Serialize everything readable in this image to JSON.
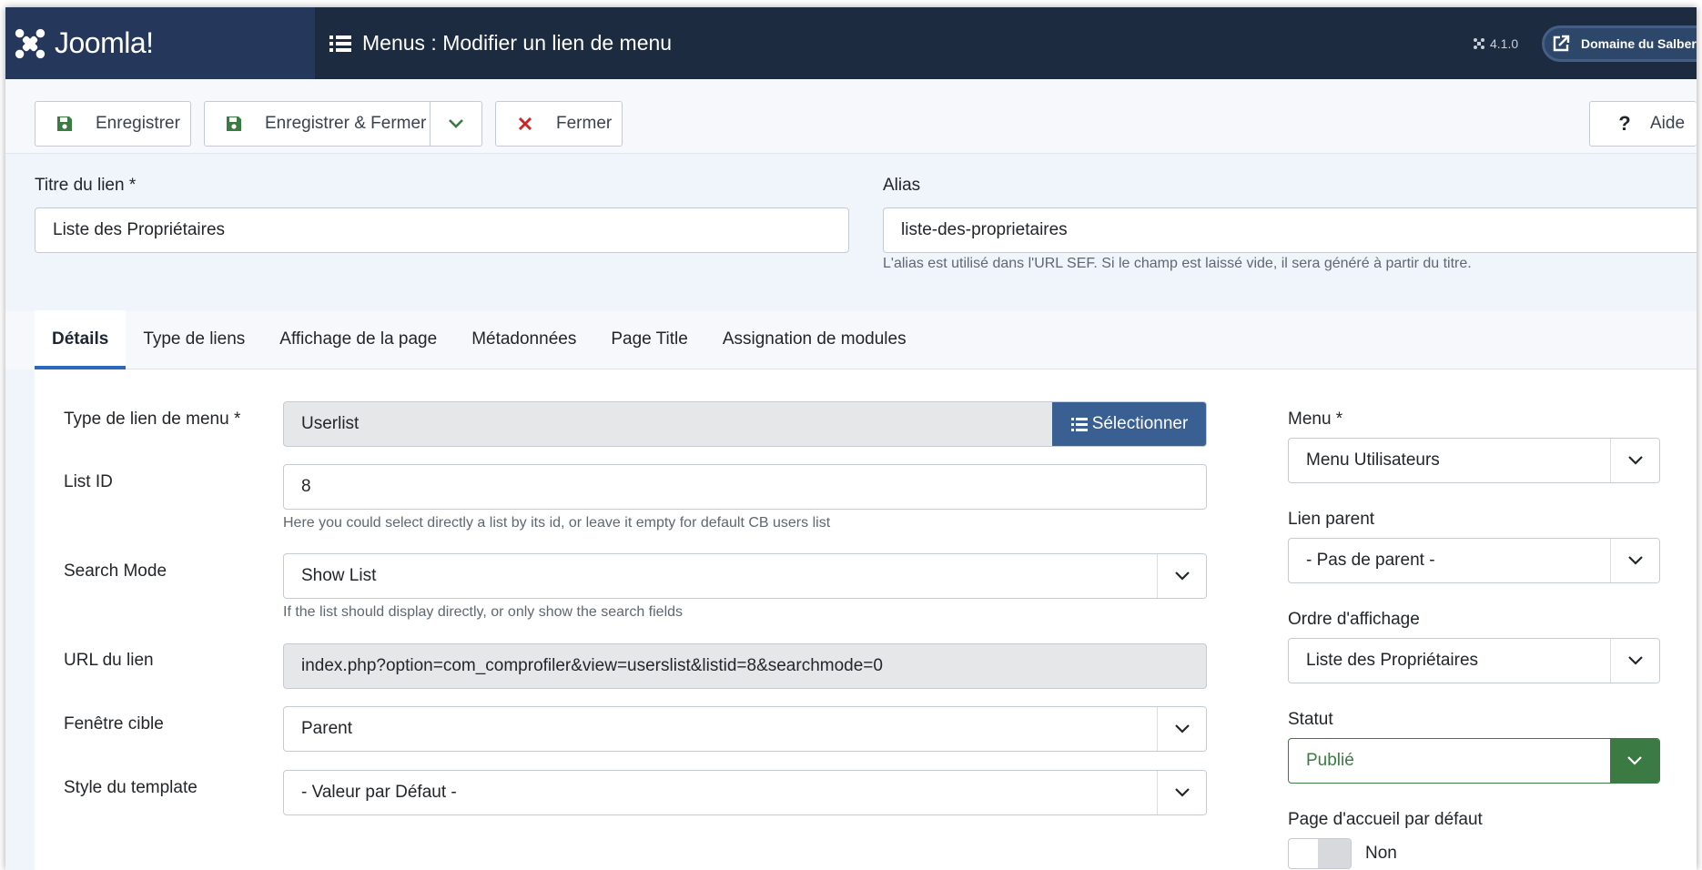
{
  "header": {
    "logo_text": "Joomla!",
    "page_title": "Menus : Modifier un lien de menu",
    "version": "4.1.0",
    "site_name": "Domaine du Salbert"
  },
  "toolbar": {
    "save_label": "Enregistrer",
    "save_close_label": "Enregistrer & Fermer",
    "close_label": "Fermer",
    "help_label": "Aide"
  },
  "title_field": {
    "label": "Titre du lien *",
    "value": "Liste des Propriétaires"
  },
  "alias_field": {
    "label": "Alias",
    "value": "liste-des-proprietaires",
    "hint": "L'alias est utilisé dans l'URL SEF. Si le champ est laissé vide, il sera généré à partir du titre."
  },
  "tabs": [
    {
      "label": "Détails",
      "active": true
    },
    {
      "label": "Type de liens",
      "active": false
    },
    {
      "label": "Affichage de la page",
      "active": false
    },
    {
      "label": "Métadonnées",
      "active": false
    },
    {
      "label": "Page Title",
      "active": false
    },
    {
      "label": "Assignation de modules",
      "active": false
    }
  ],
  "details": {
    "menu_item_type": {
      "label": "Type de lien de menu *",
      "value": "Userlist",
      "button": "Sélectionner"
    },
    "list_id": {
      "label": "List ID",
      "value": "8",
      "hint": "Here you could select directly a list by its id, or leave it empty for default CB users list"
    },
    "search_mode": {
      "label": "Search Mode",
      "value": "Show List",
      "hint": "If the list should display directly, or only show the search fields"
    },
    "link_url": {
      "label": "URL du lien",
      "value": "index.php?option=com_comprofiler&view=userslist&listid=8&searchmode=0"
    },
    "target_window": {
      "label": "Fenêtre cible",
      "value": "Parent"
    },
    "template_style": {
      "label": "Style du template",
      "value": "- Valeur par Défaut -"
    }
  },
  "sidebar": {
    "menu": {
      "label": "Menu *",
      "value": "Menu Utilisateurs"
    },
    "parent_item": {
      "label": "Lien parent",
      "value": "- Pas de parent -"
    },
    "ordering": {
      "label": "Ordre d'affichage",
      "value": "Liste des Propriétaires"
    },
    "status": {
      "label": "Statut",
      "value": "Publié"
    },
    "default_page": {
      "label": "Page d'accueil par défaut",
      "value": "Non"
    }
  },
  "colors": {
    "header_bg": "#1c2b3f",
    "logo_bg": "#25385b",
    "primary": "#3a5f92",
    "success": "#3b7a43",
    "danger": "#c52827",
    "tab_accent": "#2a69b8"
  }
}
